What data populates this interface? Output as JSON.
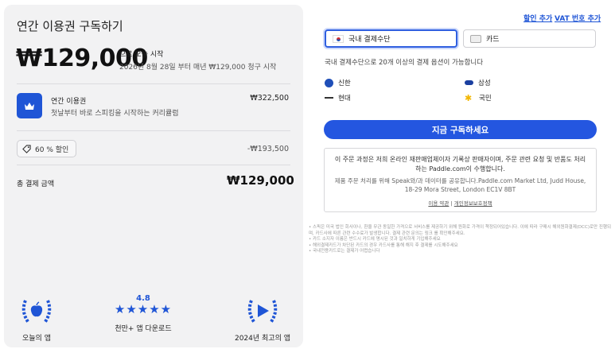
{
  "summary": {
    "title": "연간 이용권 구독하기",
    "price": "₩129,000",
    "start_label": "으로 오늘 시작",
    "billing_note": "2026년 8월 28일 부터 매년 ₩129,000 청구 시작",
    "plan_name": "연간 이용권",
    "plan_desc": "첫날부터 바로 스피킹을 시작하는 커리큘럼",
    "plan_price": "₩322,500",
    "discount_label": "60 % 할인",
    "discount_amount": "-₩193,500",
    "total_label": "총 결제 금액",
    "total_amount": "₩129,000"
  },
  "badges": {
    "today_app": "오늘의 앱",
    "rating": "4.8",
    "stars": "★★★★★",
    "downloads": "천만+ 앱 다운로드",
    "best_app": "2024년 최고의 앱"
  },
  "payment": {
    "add_discount": "할인 추가",
    "add_vat": "VAT 번호 추가",
    "method_domestic": "국내 결제수단",
    "method_card": "카드",
    "info": "국내 결제수단으로 20개 이상의 결제 옵션이 가능합니다",
    "banks": [
      "신한",
      "삼성",
      "현대",
      "국민"
    ],
    "subscribe_button": "지금 구독하세요",
    "merchant_text": "이 주문 과정은 저희 온라인 재판매업체이자 기록상 판매자이며, 주문 관련 요청 및 반품도 처리하는 Paddle.com이 수행합니다.",
    "share_text": "제품 주문 처리를 위해 Speak와/과 데이터를 공유합니다.Paddle.com Market Ltd, Judd House, 18-29 Mora Street, London EC1V 8BT",
    "terms_link": "이용 약관",
    "separator": "|",
    "privacy_link": "개인정보보호정책"
  },
  "notes": [
    "스픽은 미국 법인 회사이나, 환율 무관 동일한 가격으로 서비스를 제공하기 위해 원화로 가격이 책정되어있습니다. 이에 따라 구매시 해외원화결제(DCC)로만 진행되며, 카드사에 따른 관련 수수료가 발생합니다. 결제 관련 문의는 링크 를 확인해주세요.",
    "카드 소지자 이름은 반드시 카드에 명시된 것과 일치하게 기입해주세요",
    "해외결제카드가 차단된 카드의 경우 카드사를 통해 해지 후 결제를 시도해주세요",
    "국내전용카드로는 결제가 어렵습니다"
  ],
  "colors": {
    "accent": "#2456e0",
    "panel": "#f2f2f3"
  }
}
